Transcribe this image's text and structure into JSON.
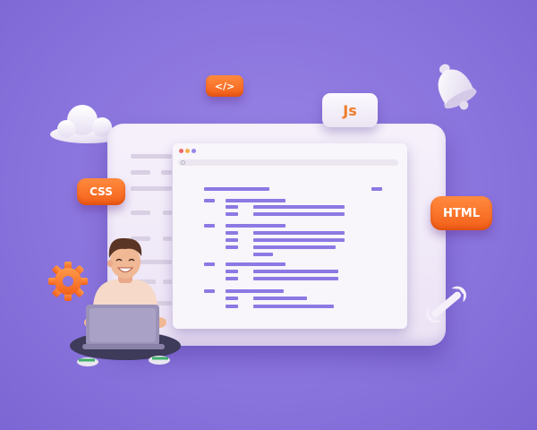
{
  "badges": {
    "tag": "</>",
    "js": "Js",
    "css": "CSS",
    "html": "HTML"
  },
  "icons": [
    "cloud-icon",
    "bell-icon",
    "gear-icon",
    "wrench-icon"
  ],
  "colors": {
    "background": "#8a74dd",
    "badge_orange": "#f76a20",
    "code_purple": "#8c79e3",
    "panel": "#f3eef8"
  }
}
